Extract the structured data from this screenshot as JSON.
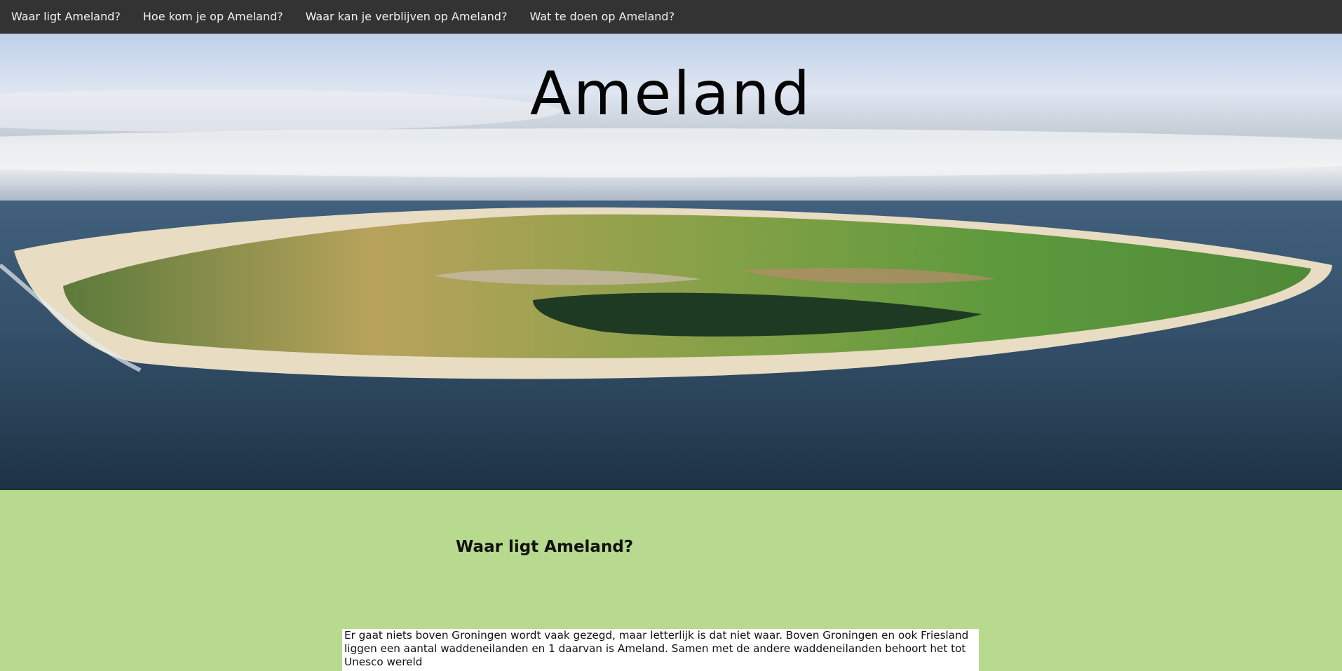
{
  "nav": {
    "items": [
      {
        "label": "Waar ligt Ameland?"
      },
      {
        "label": "Hoe kom je op Ameland?"
      },
      {
        "label": "Waar kan je verblijven op Ameland?"
      },
      {
        "label": "Wat te doen op Ameland?"
      }
    ]
  },
  "hero": {
    "title": "Ameland"
  },
  "section": {
    "title": "Waar ligt Ameland?",
    "paragraph": "Er gaat niets boven Groningen wordt vaak gezegd, maar letterlijk is dat niet waar. Boven Groningen en ook Friesland liggen een aantal waddeneilanden en 1 daarvan is Ameland. Samen met de andere waddeneilanden behoort het tot Unesco wereld"
  },
  "colors": {
    "nav_bg": "#333333",
    "nav_text": "#f2f2f2",
    "section_bg": "#b7da8e"
  }
}
